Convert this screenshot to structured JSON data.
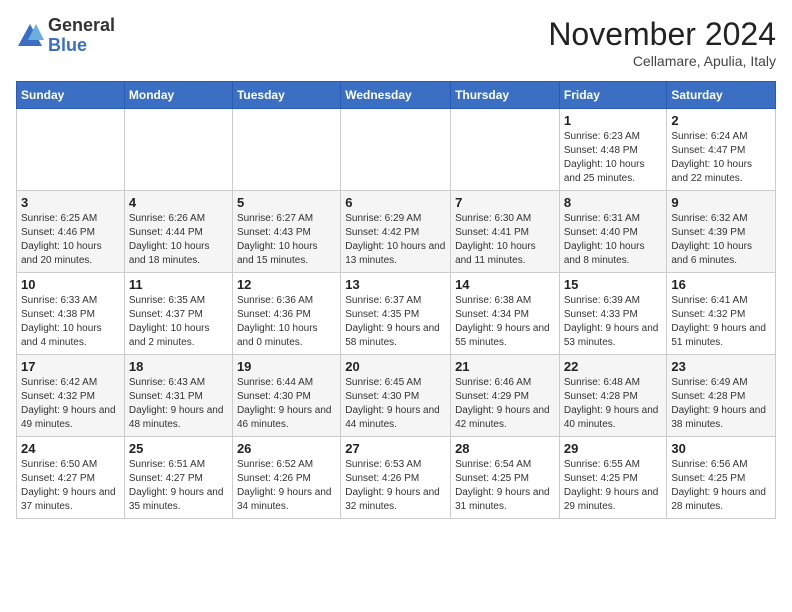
{
  "logo": {
    "general": "General",
    "blue": "Blue"
  },
  "header": {
    "title": "November 2024",
    "subtitle": "Cellamare, Apulia, Italy"
  },
  "weekdays": [
    "Sunday",
    "Monday",
    "Tuesday",
    "Wednesday",
    "Thursday",
    "Friday",
    "Saturday"
  ],
  "weeks": [
    [
      {
        "day": "",
        "info": ""
      },
      {
        "day": "",
        "info": ""
      },
      {
        "day": "",
        "info": ""
      },
      {
        "day": "",
        "info": ""
      },
      {
        "day": "",
        "info": ""
      },
      {
        "day": "1",
        "info": "Sunrise: 6:23 AM\nSunset: 4:48 PM\nDaylight: 10 hours and 25 minutes."
      },
      {
        "day": "2",
        "info": "Sunrise: 6:24 AM\nSunset: 4:47 PM\nDaylight: 10 hours and 22 minutes."
      }
    ],
    [
      {
        "day": "3",
        "info": "Sunrise: 6:25 AM\nSunset: 4:46 PM\nDaylight: 10 hours and 20 minutes."
      },
      {
        "day": "4",
        "info": "Sunrise: 6:26 AM\nSunset: 4:44 PM\nDaylight: 10 hours and 18 minutes."
      },
      {
        "day": "5",
        "info": "Sunrise: 6:27 AM\nSunset: 4:43 PM\nDaylight: 10 hours and 15 minutes."
      },
      {
        "day": "6",
        "info": "Sunrise: 6:29 AM\nSunset: 4:42 PM\nDaylight: 10 hours and 13 minutes."
      },
      {
        "day": "7",
        "info": "Sunrise: 6:30 AM\nSunset: 4:41 PM\nDaylight: 10 hours and 11 minutes."
      },
      {
        "day": "8",
        "info": "Sunrise: 6:31 AM\nSunset: 4:40 PM\nDaylight: 10 hours and 8 minutes."
      },
      {
        "day": "9",
        "info": "Sunrise: 6:32 AM\nSunset: 4:39 PM\nDaylight: 10 hours and 6 minutes."
      }
    ],
    [
      {
        "day": "10",
        "info": "Sunrise: 6:33 AM\nSunset: 4:38 PM\nDaylight: 10 hours and 4 minutes."
      },
      {
        "day": "11",
        "info": "Sunrise: 6:35 AM\nSunset: 4:37 PM\nDaylight: 10 hours and 2 minutes."
      },
      {
        "day": "12",
        "info": "Sunrise: 6:36 AM\nSunset: 4:36 PM\nDaylight: 10 hours and 0 minutes."
      },
      {
        "day": "13",
        "info": "Sunrise: 6:37 AM\nSunset: 4:35 PM\nDaylight: 9 hours and 58 minutes."
      },
      {
        "day": "14",
        "info": "Sunrise: 6:38 AM\nSunset: 4:34 PM\nDaylight: 9 hours and 55 minutes."
      },
      {
        "day": "15",
        "info": "Sunrise: 6:39 AM\nSunset: 4:33 PM\nDaylight: 9 hours and 53 minutes."
      },
      {
        "day": "16",
        "info": "Sunrise: 6:41 AM\nSunset: 4:32 PM\nDaylight: 9 hours and 51 minutes."
      }
    ],
    [
      {
        "day": "17",
        "info": "Sunrise: 6:42 AM\nSunset: 4:32 PM\nDaylight: 9 hours and 49 minutes."
      },
      {
        "day": "18",
        "info": "Sunrise: 6:43 AM\nSunset: 4:31 PM\nDaylight: 9 hours and 48 minutes."
      },
      {
        "day": "19",
        "info": "Sunrise: 6:44 AM\nSunset: 4:30 PM\nDaylight: 9 hours and 46 minutes."
      },
      {
        "day": "20",
        "info": "Sunrise: 6:45 AM\nSunset: 4:30 PM\nDaylight: 9 hours and 44 minutes."
      },
      {
        "day": "21",
        "info": "Sunrise: 6:46 AM\nSunset: 4:29 PM\nDaylight: 9 hours and 42 minutes."
      },
      {
        "day": "22",
        "info": "Sunrise: 6:48 AM\nSunset: 4:28 PM\nDaylight: 9 hours and 40 minutes."
      },
      {
        "day": "23",
        "info": "Sunrise: 6:49 AM\nSunset: 4:28 PM\nDaylight: 9 hours and 38 minutes."
      }
    ],
    [
      {
        "day": "24",
        "info": "Sunrise: 6:50 AM\nSunset: 4:27 PM\nDaylight: 9 hours and 37 minutes."
      },
      {
        "day": "25",
        "info": "Sunrise: 6:51 AM\nSunset: 4:27 PM\nDaylight: 9 hours and 35 minutes."
      },
      {
        "day": "26",
        "info": "Sunrise: 6:52 AM\nSunset: 4:26 PM\nDaylight: 9 hours and 34 minutes."
      },
      {
        "day": "27",
        "info": "Sunrise: 6:53 AM\nSunset: 4:26 PM\nDaylight: 9 hours and 32 minutes."
      },
      {
        "day": "28",
        "info": "Sunrise: 6:54 AM\nSunset: 4:25 PM\nDaylight: 9 hours and 31 minutes."
      },
      {
        "day": "29",
        "info": "Sunrise: 6:55 AM\nSunset: 4:25 PM\nDaylight: 9 hours and 29 minutes."
      },
      {
        "day": "30",
        "info": "Sunrise: 6:56 AM\nSunset: 4:25 PM\nDaylight: 9 hours and 28 minutes."
      }
    ]
  ]
}
